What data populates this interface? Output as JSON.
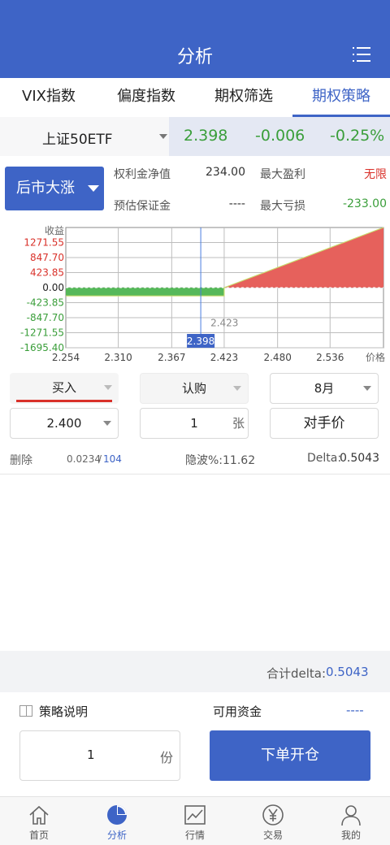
{
  "header": {
    "title": "分析"
  },
  "tabs": [
    {
      "label": "VIX指数"
    },
    {
      "label": "偏度指数"
    },
    {
      "label": "期权筛选"
    },
    {
      "label": "期权策略",
      "active": true
    }
  ],
  "quote": {
    "symbol": "上证50ETF",
    "price": "2.398",
    "change": "-0.006",
    "change_pct": "-0.25%"
  },
  "strategy": {
    "direction": "后市大涨",
    "premium_label": "权利金净值",
    "premium_value": "234.00",
    "max_profit_label": "最大盈利",
    "max_profit_value": "无限",
    "margin_label": "预估保证金",
    "margin_value": "----",
    "max_loss_label": "最大亏损",
    "max_loss_value": "-233.00"
  },
  "chart_data": {
    "type": "area",
    "ylabel": "收益",
    "xlabel": "价格",
    "x_ticks": [
      "2.254",
      "2.310",
      "2.367",
      "2.423",
      "2.480",
      "2.536"
    ],
    "y_ticks": [
      "1271.55",
      "847.70",
      "423.85",
      "0.00",
      "-423.85",
      "-847.70",
      "-1271.55",
      "-1695.40"
    ],
    "ylim": [
      -1695.4,
      1695.4
    ],
    "xlim": [
      2.254,
      2.593
    ],
    "series": [
      {
        "x": [
          2.254,
          2.4,
          2.423
        ],
        "y": [
          -233.0,
          -233.0,
          -233.0
        ]
      },
      {
        "x": [
          2.423,
          2.593
        ],
        "y": [
          0.0,
          1695.4
        ]
      }
    ],
    "current_price": "2.398",
    "breakeven_label": "2.423"
  },
  "order": {
    "side": "买入",
    "option_type": "认购",
    "month": "8月",
    "strike": "2.400",
    "qty": "1",
    "qty_unit": "张",
    "price_type": "对手价"
  },
  "stats": {
    "delete_label": "删除",
    "price": "0.0234",
    "price_sep": "/",
    "volume": "104",
    "iv": "隐波%:11.62",
    "delta_label": "Delta:",
    "delta_value": "0.5043"
  },
  "total": {
    "label": "合计delta:",
    "value": "0.5043"
  },
  "bottom": {
    "explain_label": "策略说明",
    "funds_label": "可用资金",
    "funds_value": "----",
    "copies": "1",
    "copies_unit": "份",
    "submit_label": "下单开仓"
  },
  "nav": [
    {
      "label": "首页",
      "icon": "home-icon"
    },
    {
      "label": "分析",
      "icon": "pie-chart-icon",
      "active": true
    },
    {
      "label": "行情",
      "icon": "trend-chart-icon"
    },
    {
      "label": "交易",
      "icon": "yen-icon"
    },
    {
      "label": "我的",
      "icon": "person-icon"
    }
  ],
  "colors": {
    "brand": "#3e64c6",
    "up": "#d9312a",
    "down": "#3a9e3a",
    "profit_fill": "#e6615c",
    "loss_fill": "#56b85a"
  }
}
